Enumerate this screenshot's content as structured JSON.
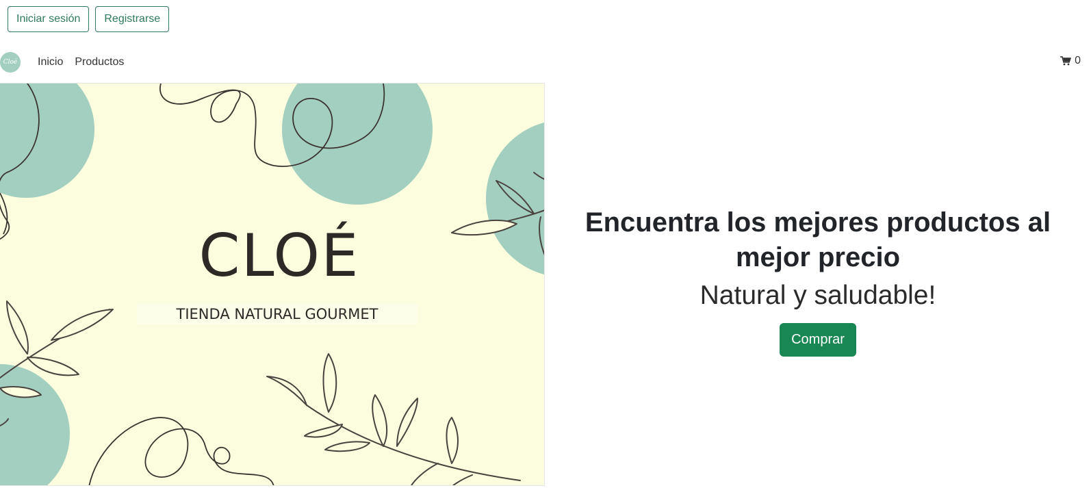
{
  "auth": {
    "login_label": "Iniciar sesión",
    "register_label": "Registrarse"
  },
  "navbar": {
    "logo_text": "Cloé",
    "links": [
      "Inicio",
      "Productos"
    ],
    "cart_count": "0",
    "cart_icon": "shopping-cart-icon"
  },
  "hero_image": {
    "brand": "CLOÉ",
    "tagline": "TIENDA NATURAL GOURMET"
  },
  "hero": {
    "title": "Encuentra los mejores productos al mejor precio",
    "subtitle": "Natural y saludable!",
    "cta_label": "Comprar"
  },
  "colors": {
    "primary": "#198754",
    "outline": "#2f7a5c",
    "banner_bg": "#fbfdde",
    "circle": "#a3cfc0",
    "ink": "#3b3330"
  }
}
